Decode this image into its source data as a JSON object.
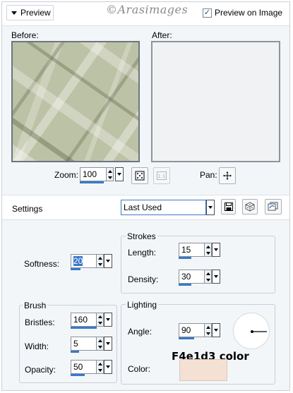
{
  "header": {
    "preview_toggle_label": "Preview",
    "watermark": "©Arasimages",
    "preview_on_image_label": "Preview on Image",
    "preview_on_image_checked": true
  },
  "preview": {
    "before_label": "Before:",
    "after_label": "After:",
    "zoom_label": "Zoom:",
    "zoom_value": "100",
    "pan_label": "Pan:"
  },
  "settings": {
    "label": "Settings",
    "preset_value": "Last Used"
  },
  "softness": {
    "label": "Softness:",
    "value": "20"
  },
  "strokes": {
    "title": "Strokes",
    "length_label": "Length:",
    "length_value": "15",
    "density_label": "Density:",
    "density_value": "30"
  },
  "brush": {
    "title": "Brush",
    "bristles_label": "Bristles:",
    "bristles_value": "160",
    "width_label": "Width:",
    "width_value": "5",
    "opacity_label": "Opacity:",
    "opacity_value": "50"
  },
  "lighting": {
    "title": "Lighting",
    "angle_label": "Angle:",
    "angle_value": "90",
    "color_label": "Color:",
    "color_caption": "F4e1d3 color",
    "color_hex": "#f4e1d3"
  },
  "icons": {
    "preview_toggle": "triangle-down-icon",
    "zoom_fit": "fit-to-window-icon",
    "zoom_actual": "actual-size-icon",
    "pan": "pan-move-icon",
    "save_preset": "save-preset-icon",
    "randomize": "randomize-dice-icon",
    "reset": "reset-defaults-icon"
  },
  "colors": {
    "accent": "#3a79c9",
    "panel_bg": "#f3f6f9",
    "swatch": "#f4e1d3"
  }
}
